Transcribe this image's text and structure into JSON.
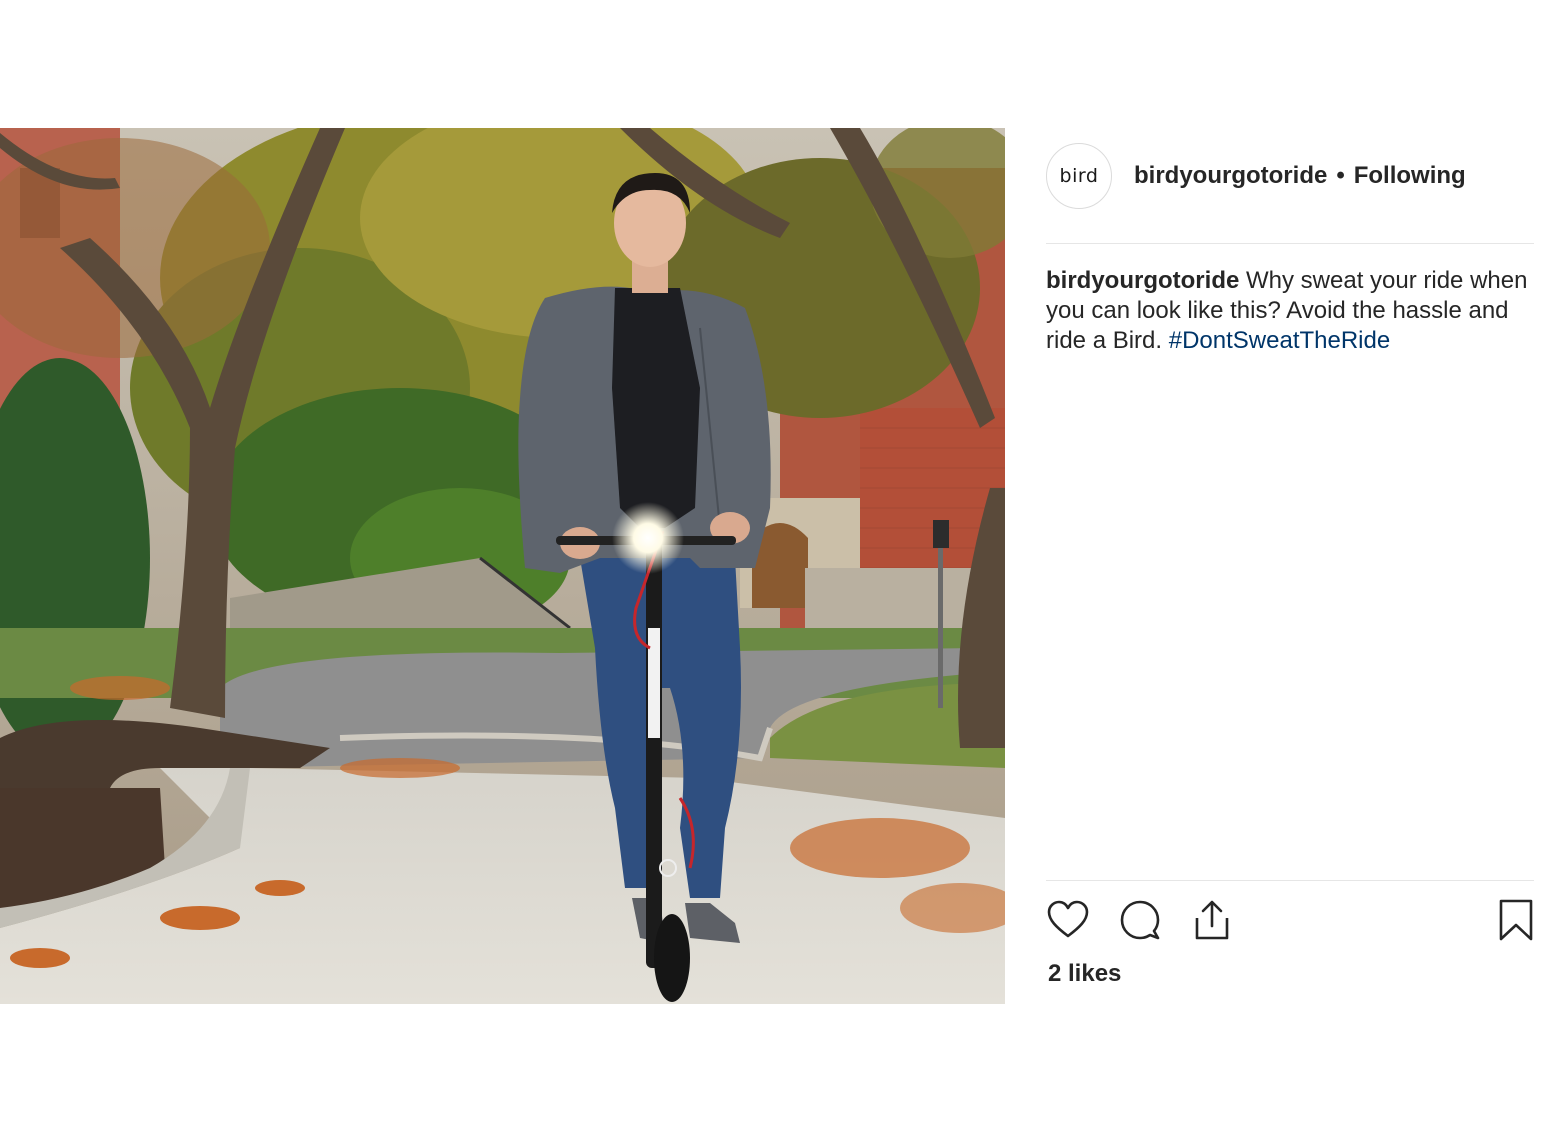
{
  "post": {
    "image_alt": "Man in gray jacket riding an electric scooter on a leafy autumn path",
    "author": {
      "avatar_text": "bird",
      "username": "birdyourgotoride",
      "separator": "•",
      "follow_state": "Following"
    },
    "caption": {
      "username": "birdyourgotoride",
      "text": "Why sweat your ride when you can look like this? Avoid the hassle and ride a Bird.",
      "hashtag": "#DontSweatTheRide"
    },
    "actions": {
      "like_icon": "heart-icon",
      "comment_icon": "comment-icon",
      "share_icon": "share-icon",
      "save_icon": "bookmark-icon"
    },
    "likes": "2 likes"
  },
  "colors": {
    "text": "#262626",
    "hashtag": "#003569",
    "divider": "#e6e6e6"
  }
}
